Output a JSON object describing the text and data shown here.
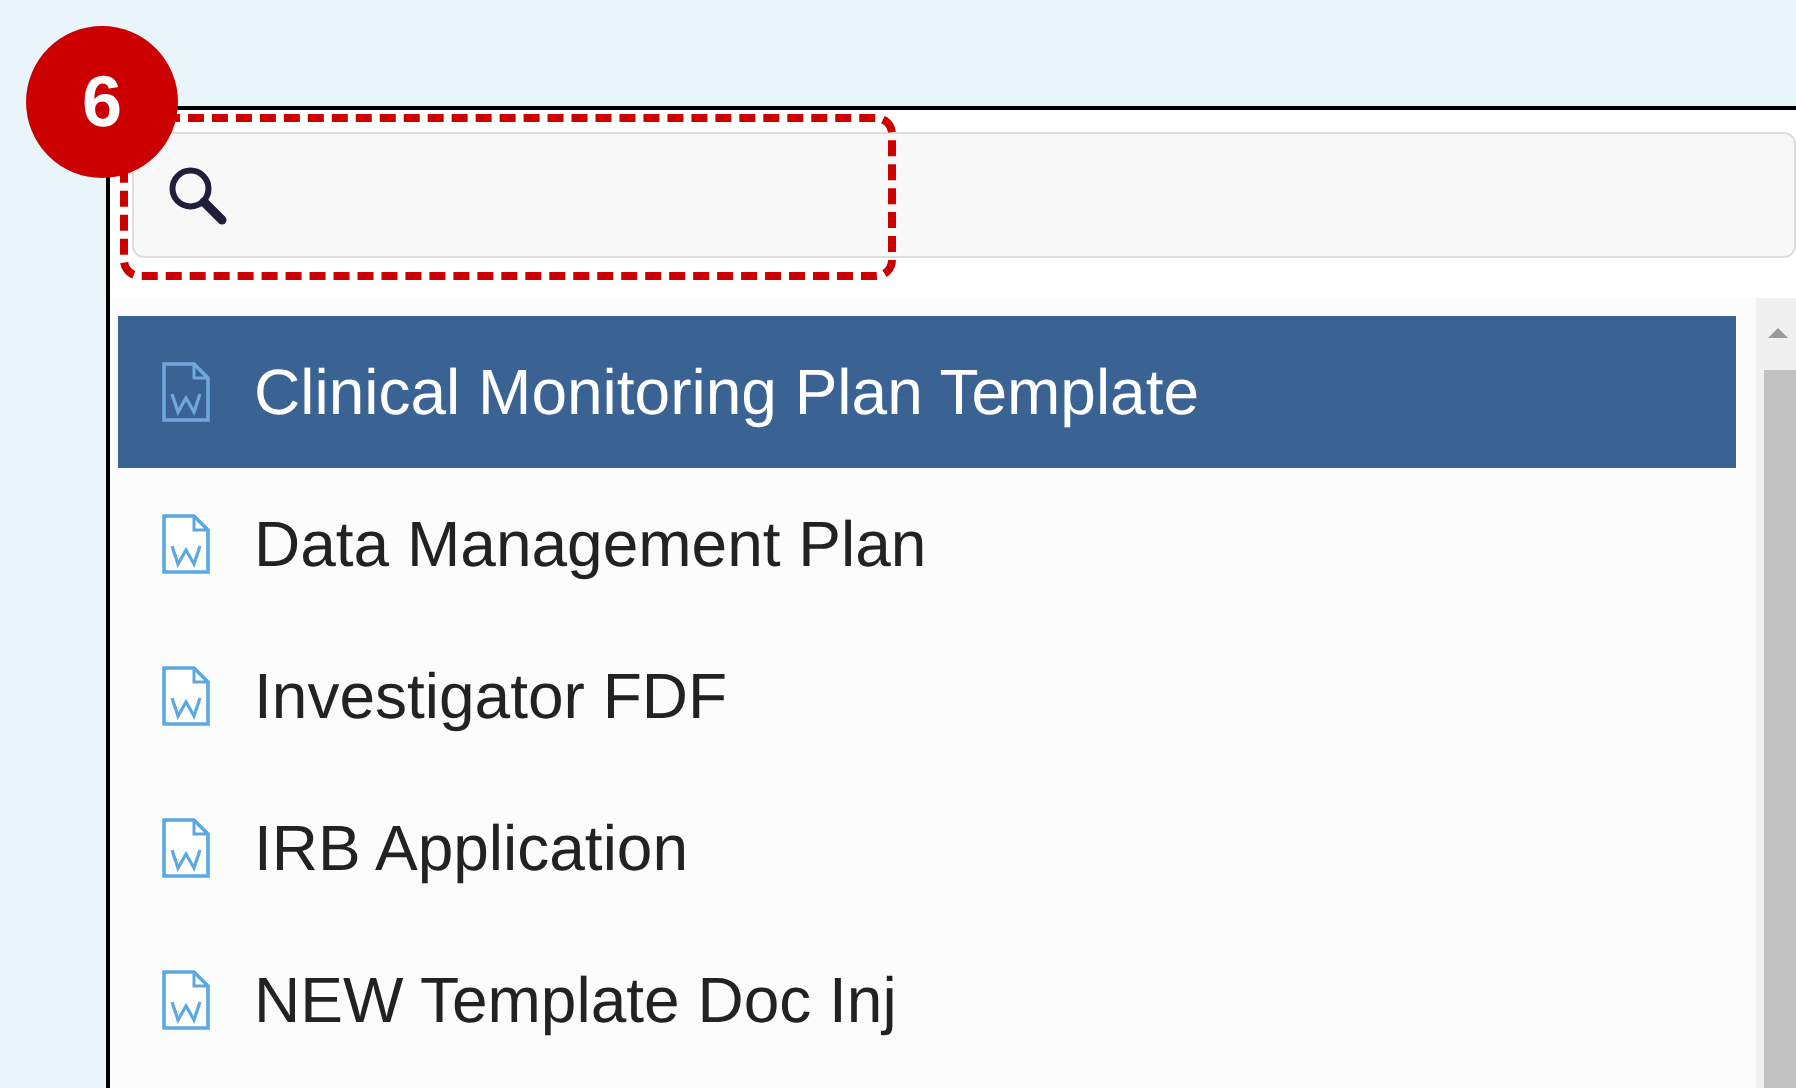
{
  "badge": "6",
  "search": {
    "highlighted": true
  },
  "items": [
    {
      "label": "Clinical Monitoring Plan Template",
      "selected": true
    },
    {
      "label": "Data Management Plan",
      "selected": false
    },
    {
      "label": "Investigator FDF",
      "selected": false
    },
    {
      "label": "IRB Application",
      "selected": false
    },
    {
      "label": "NEW Template Doc Inj",
      "selected": false
    }
  ]
}
